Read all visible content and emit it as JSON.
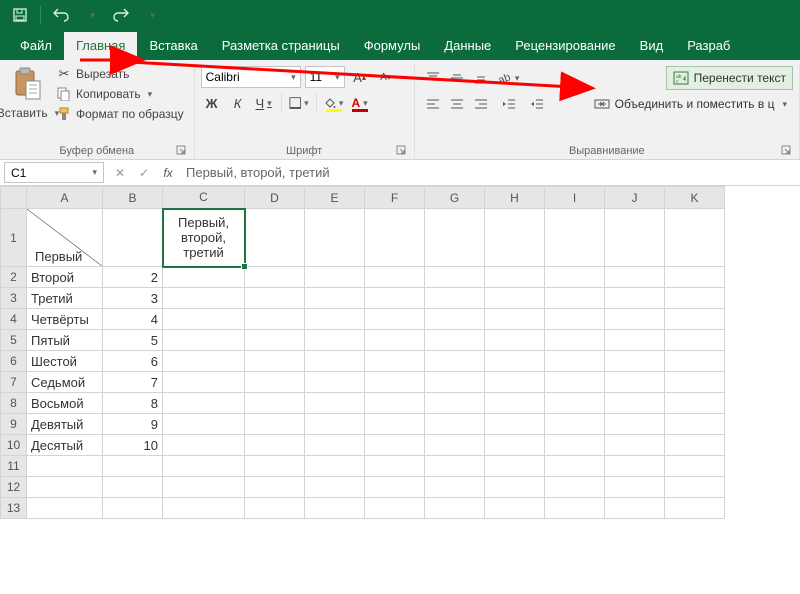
{
  "qat": {
    "save": "save",
    "undo": "undo",
    "redo": "redo"
  },
  "tabs": {
    "file": "Файл",
    "home": "Главная",
    "insert": "Вставка",
    "pagelayout": "Разметка страницы",
    "formulas": "Формулы",
    "data": "Данные",
    "review": "Рецензирование",
    "view": "Вид",
    "dev": "Разраб"
  },
  "clipboard": {
    "paste": "Вставить",
    "cut": "Вырезать",
    "copy": "Копировать",
    "format_painter": "Формат по образцу",
    "group": "Буфер обмена"
  },
  "font": {
    "face": "Calibri",
    "size": "11",
    "group": "Шрифт",
    "bold": "Ж",
    "italic": "К",
    "underline": "Ч"
  },
  "alignment": {
    "group": "Выравнивание",
    "wrap": "Перенести текст",
    "merge": "Объединить и поместить в ц"
  },
  "fbar": {
    "namebox": "C1",
    "formula": "Первый, второй, третий"
  },
  "columns": [
    "A",
    "B",
    "C",
    "D",
    "E",
    "F",
    "G",
    "H",
    "I",
    "J",
    "K"
  ],
  "rows": [
    {
      "n": 1,
      "A": "Первый",
      "B": "",
      "C": "Первый, второй, третий"
    },
    {
      "n": 2,
      "A": "Второй",
      "B": "2"
    },
    {
      "n": 3,
      "A": "Третий",
      "B": "3"
    },
    {
      "n": 4,
      "A": "Четвёрты",
      "B": "4"
    },
    {
      "n": 5,
      "A": "Пятый",
      "B": "5"
    },
    {
      "n": 6,
      "A": "Шестой",
      "B": "6"
    },
    {
      "n": 7,
      "A": "Седьмой",
      "B": "7"
    },
    {
      "n": 8,
      "A": "Восьмой",
      "B": "8"
    },
    {
      "n": 9,
      "A": "Девятый",
      "B": "9"
    },
    {
      "n": 10,
      "A": "Десятый",
      "B": "10"
    },
    {
      "n": 11
    },
    {
      "n": 12
    },
    {
      "n": 13
    }
  ]
}
